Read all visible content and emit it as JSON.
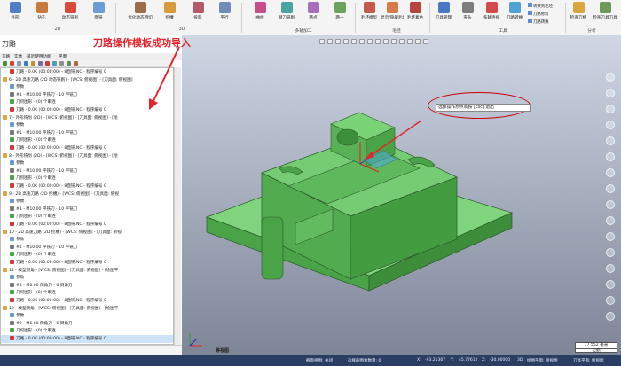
{
  "ribbon": {
    "buttons": [
      "外形",
      "钻孔",
      "动态铣削",
      "面铣",
      "优化动态粗切",
      "挖槽",
      "投影",
      "平行",
      "曲线",
      "钢刀铣削",
      "两点",
      "两一",
      "毛坯模型",
      "显示/隐藏毛坯",
      "毛坯着色",
      "刀具管理",
      "夹头",
      "多轴连接",
      "刀路转换",
      "转换到毛坯",
      "刀路修剪",
      "刀路转换",
      "检查刀柄",
      "检查刀具刀具"
    ],
    "groups": [
      "2D",
      "3D",
      "多轴加工",
      "毛坯",
      "工具",
      "分析"
    ]
  },
  "panel": {
    "title": "刀路"
  },
  "tabs": [
    "刀路",
    "实体",
    "最近使用功能",
    "平面"
  ],
  "tree": [
    {
      "text": "刀路 - 0.0K (00:00:00) - 8面铣.NC - 程序编号 0",
      "icon": "path"
    },
    {
      "text": "6 - 2D 高速刀路 (2D 动态铣削) - [WCS: 俯视图] - [刀具面: 俯视图]",
      "icon": "op"
    },
    {
      "text": "参数",
      "icon": "param"
    },
    {
      "text": "#1 - M10.00 平铣刀 - 10 平铣刀",
      "icon": "tool"
    },
    {
      "text": "几何图形 - (0) 个串连",
      "icon": "geom"
    },
    {
      "text": "刀路 - 0.0K (00:00:00) - 8面铣.NC - 程序编号 0",
      "icon": "path"
    },
    {
      "text": "7 - 外形铣削 (2D) - [WCS: 俯视图] - [刀具面: 俯视图] - [绘",
      "icon": "op"
    },
    {
      "text": "参数",
      "icon": "param"
    },
    {
      "text": "#1 - M10.00 平铣刀 - 10 平铣刀",
      "icon": "tool"
    },
    {
      "text": "几何图形 - (0) 个串连",
      "icon": "geom"
    },
    {
      "text": "刀路 - 0.0K (00:00:00) - 8面铣.NC - 程序编号 0",
      "icon": "path"
    },
    {
      "text": "8 - 外形铣削 (2D) - [WCS: 俯视图] - [刀具面: 俯视图] - [绘",
      "icon": "op"
    },
    {
      "text": "参数",
      "icon": "param"
    },
    {
      "text": "#1 - M10.00 平铣刀 - 10 平铣刀",
      "icon": "tool"
    },
    {
      "text": "几何图形 - (0) 个串连",
      "icon": "geom"
    },
    {
      "text": "刀路 - 0.0K (00:00:00) - 8面铣.NC - 程序编号 0",
      "icon": "path"
    },
    {
      "text": "9 - 2D 高速刀路 (2D 挖槽) - [WCS: 俯视图] - [刀具面: 俯视",
      "icon": "op"
    },
    {
      "text": "参数",
      "icon": "param"
    },
    {
      "text": "#1 - M10.00 平铣刀 - 10 平铣刀",
      "icon": "tool"
    },
    {
      "text": "几何图形 - (0) 个串连",
      "icon": "geom"
    },
    {
      "text": "刀路 - 0.0K (00:00:00) - 8面铣.NC - 程序编号 0",
      "icon": "path"
    },
    {
      "text": "10 - 2D 高速刀路 (2D 挖槽) - [WCS: 俯视图] - [刀具面: 俯视",
      "icon": "op"
    },
    {
      "text": "参数",
      "icon": "param"
    },
    {
      "text": "#1 - M10.00 平铣刀 - 10 平铣刀",
      "icon": "tool"
    },
    {
      "text": "几何图形 - (0) 个串连",
      "icon": "geom"
    },
    {
      "text": "刀路 - 0.0K (00:00:00) - 8面铣.NC - 程序编号 0",
      "icon": "path"
    },
    {
      "text": "11 - 模型倒角 - [WCS: 俯视图] - [刀具面: 俯视图] - [绘图平",
      "icon": "op"
    },
    {
      "text": "参数",
      "icon": "param"
    },
    {
      "text": "#2 - M6.00 倒角刀 - 6 倒角刀",
      "icon": "tool"
    },
    {
      "text": "几何图形 - (0) 个串连",
      "icon": "geom"
    },
    {
      "text": "刀路 - 0.0K (00:00:00) - 8面铣.NC - 程序编号 0",
      "icon": "path"
    },
    {
      "text": "12 - 模型倒角 - [WCS: 俯视图] - [刀具面: 俯视图] - [绘图平",
      "icon": "op"
    },
    {
      "text": "参数",
      "icon": "param"
    },
    {
      "text": "#2 - M6.00 倒角刀 - 6 倒角刀",
      "icon": "tool"
    },
    {
      "text": "几何图形 - (0) 个串连",
      "icon": "geom"
    },
    {
      "text": "刀路 - 0.0K (00:00:00) - 8面铣.NC - 程序编号 0",
      "icon": "path"
    }
  ],
  "annotation": "刀路操作模板成功导入",
  "viewport": {
    "prompt": "选择操作原点或按 [Esc] 退出",
    "view_name": "等视图",
    "scale_value": "17.552 毫米",
    "scale_unit": "公制"
  },
  "statusbar": {
    "section": "截面视图: 关闭",
    "selected": "选择的图素数量: 0",
    "x_label": "X:",
    "x": "-93.21367",
    "y_label": "Y:",
    "y": "45.77612",
    "z_label": "Z:",
    "z": "-30.00000",
    "mode": "3D",
    "plane": "绘图平面: 俯视图",
    "toolplane": "刀具平面: 俯视图"
  },
  "colors": {
    "model": "#5cb85a",
    "status": "#2a3e63",
    "accent": "#e8222a"
  }
}
